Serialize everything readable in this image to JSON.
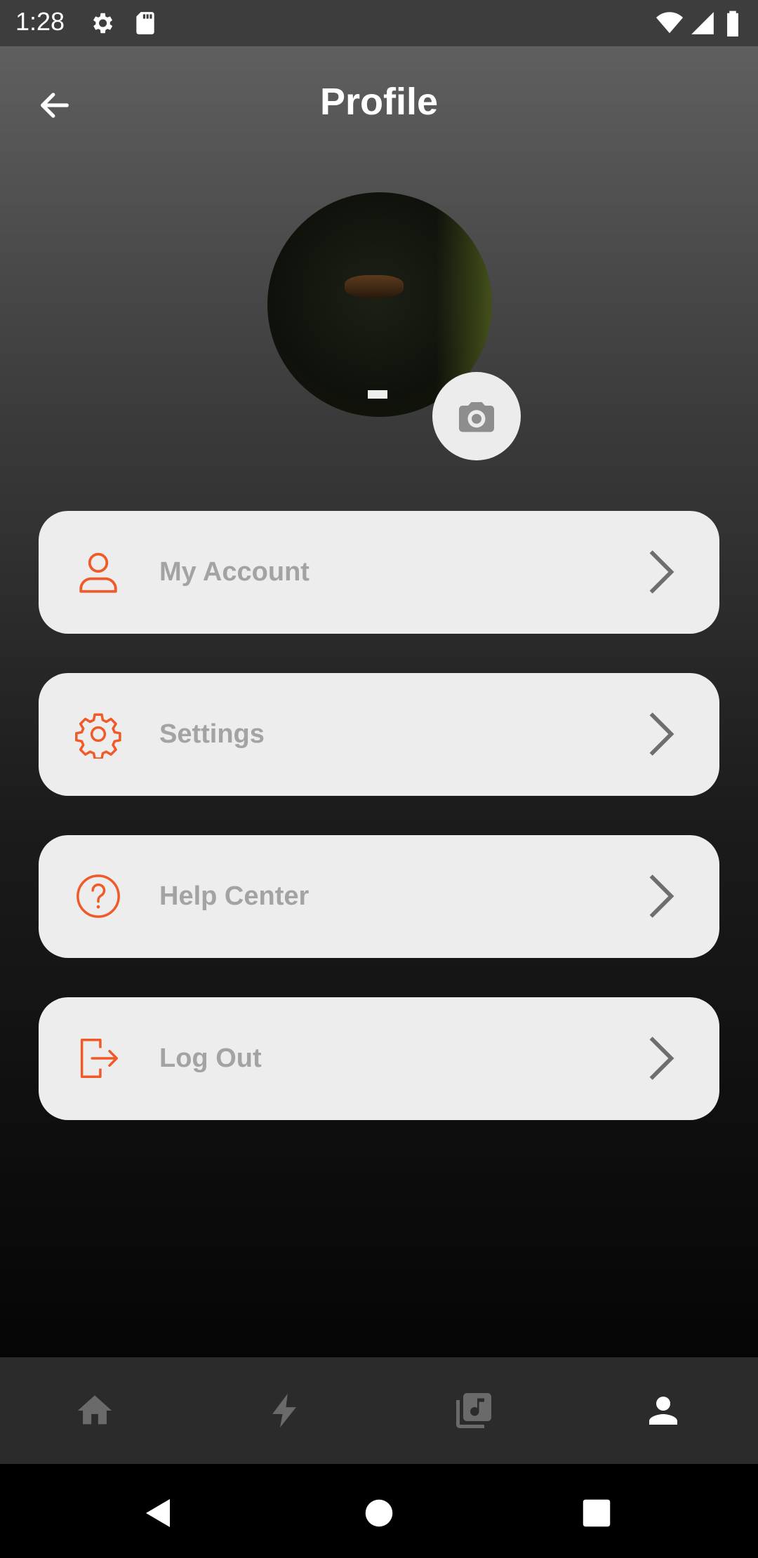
{
  "status_bar": {
    "time": "1:28",
    "icons": [
      "settings-icon",
      "sd-card-icon",
      "wifi-icon",
      "signal-icon",
      "battery-icon"
    ]
  },
  "header": {
    "title": "Profile",
    "back_icon": "arrow-left-icon"
  },
  "avatar": {
    "camera_icon": "camera-icon"
  },
  "menu": {
    "items": [
      {
        "label": "My Account",
        "icon": "user-icon"
      },
      {
        "label": "Settings",
        "icon": "gear-icon"
      },
      {
        "label": "Help Center",
        "icon": "help-icon"
      },
      {
        "label": "Log Out",
        "icon": "logout-icon"
      }
    ],
    "accent_color": "#f05a28"
  },
  "bottom_nav": {
    "items": [
      {
        "icon": "home-icon",
        "active": false
      },
      {
        "icon": "bolt-icon",
        "active": false
      },
      {
        "icon": "library-music-icon",
        "active": false
      },
      {
        "icon": "person-icon",
        "active": true
      }
    ],
    "active_color": "#ffffff",
    "inactive_color": "#6a6a6a"
  },
  "system_nav": {
    "items": [
      "back-triangle-icon",
      "home-circle-icon",
      "recents-square-icon"
    ]
  }
}
